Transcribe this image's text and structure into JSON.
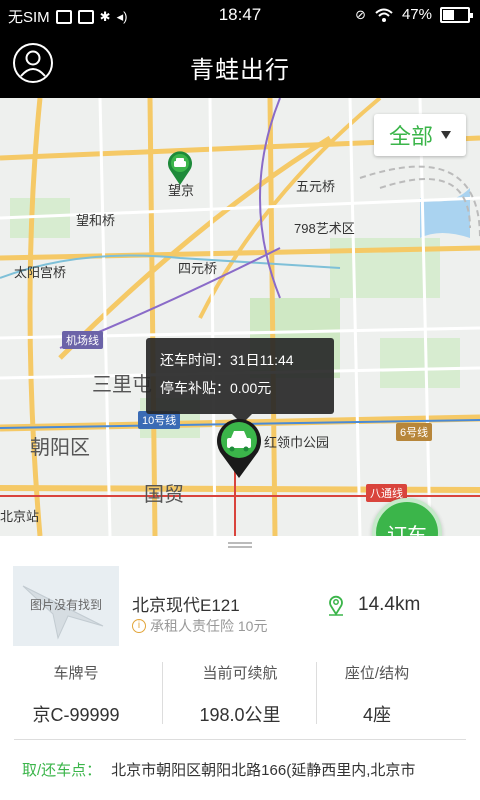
{
  "status_bar": {
    "carrier": "无SIM",
    "time": "18:47",
    "battery": "47%",
    "battery_level": 0.47
  },
  "header": {
    "title": "青蛙出行",
    "profile_icon": "user-outline-icon"
  },
  "map": {
    "filter_label": "全部",
    "labels": {
      "wangjing": "望京",
      "wuyuanqiao": "五元桥",
      "art798": "798艺术区",
      "wanghe": "望和桥",
      "taiyanggong": "太阳宫桥",
      "siyuan": "四元桥",
      "airport_line": "机场线",
      "sanlitun": "三里屯",
      "line10": "10号线",
      "chaoyang": "朝阳区",
      "hongling": "红领巾公园",
      "line6": "6号线",
      "guomao": "国贸",
      "batong": "八通线",
      "beijing_station": "北京站"
    },
    "tooltip": {
      "return_time": "还车时间：31日11:44",
      "parking_subsidy": "停车补贴：0.00元"
    },
    "order_button": "订车",
    "colors": {
      "accent": "#3bb54a",
      "road_major": "#f5c966",
      "road_minor": "#ffffff",
      "park": "#cfe8c4"
    }
  },
  "car": {
    "image_placeholder": "图片没有找到",
    "name": "北京现代E121",
    "insurance": "承租人责任险 10元",
    "distance": "14.4km",
    "stats": [
      {
        "label": "车牌号",
        "value": "京C-99999"
      },
      {
        "label": "当前可续航",
        "value": "198.0公里"
      },
      {
        "label": "座位/结构",
        "value": "4座"
      }
    ],
    "address_label": "取/还车点：",
    "address": "北京市朝阳区朝阳北路166(延静西里内,北京市"
  }
}
